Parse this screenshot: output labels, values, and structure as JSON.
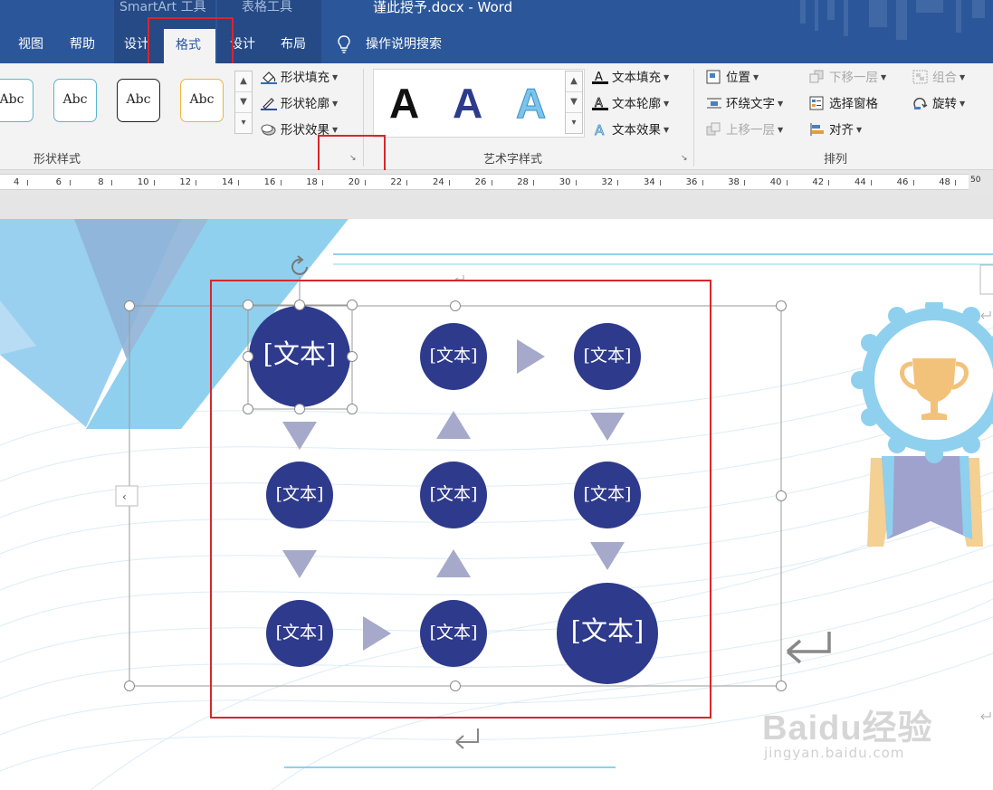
{
  "titlebar": {
    "context_smartart": "SmartArt 工具",
    "context_table": "表格工具",
    "doc_title": "谨此授予.docx  -  Word"
  },
  "tabs": [
    {
      "label": "视图"
    },
    {
      "label": "帮助"
    },
    {
      "label": "设计"
    },
    {
      "label": "格式"
    },
    {
      "label": "设计"
    },
    {
      "label": "布局"
    }
  ],
  "search_tab": {
    "label": "操作说明搜索"
  },
  "ribbon": {
    "shape_styles": {
      "group_label": "形状样式",
      "thumbnail_label": "Abc",
      "fill": "形状填充",
      "outline": "形状轮廓",
      "effects": "形状效果"
    },
    "wordart": {
      "group_label": "艺术字样式",
      "sample_letter": "A",
      "text_fill": "文本填充",
      "text_outline": "文本轮廓",
      "text_effects": "文本效果"
    },
    "arrange": {
      "group_label": "排列",
      "position": "位置",
      "wrap_text": "环绕文字",
      "bring_forward": "上移一层",
      "send_backward": "下移一层",
      "selection_pane": "选择窗格",
      "align": "对齐",
      "group": "组合",
      "rotate": "旋转"
    }
  },
  "ruler": {
    "ticks": [
      "4",
      "6",
      "8",
      "10",
      "12",
      "14",
      "16",
      "18",
      "20",
      "22",
      "24",
      "26",
      "28",
      "30",
      "32",
      "34",
      "36",
      "38",
      "40",
      "42",
      "44",
      "46",
      "48"
    ],
    "end_label": "50"
  },
  "smartart": {
    "node_text": "[文本]"
  },
  "watermark": {
    "main": "Baidu经验",
    "sub": "jingyan.baidu.com"
  },
  "colors": {
    "title_bar": "#2b579a",
    "node_fill": "#2e3a8c",
    "arrow": "#a6a9c9",
    "highlight": "#d9262b",
    "badge": "#8fd0ef",
    "trophy": "#f3c27a"
  }
}
